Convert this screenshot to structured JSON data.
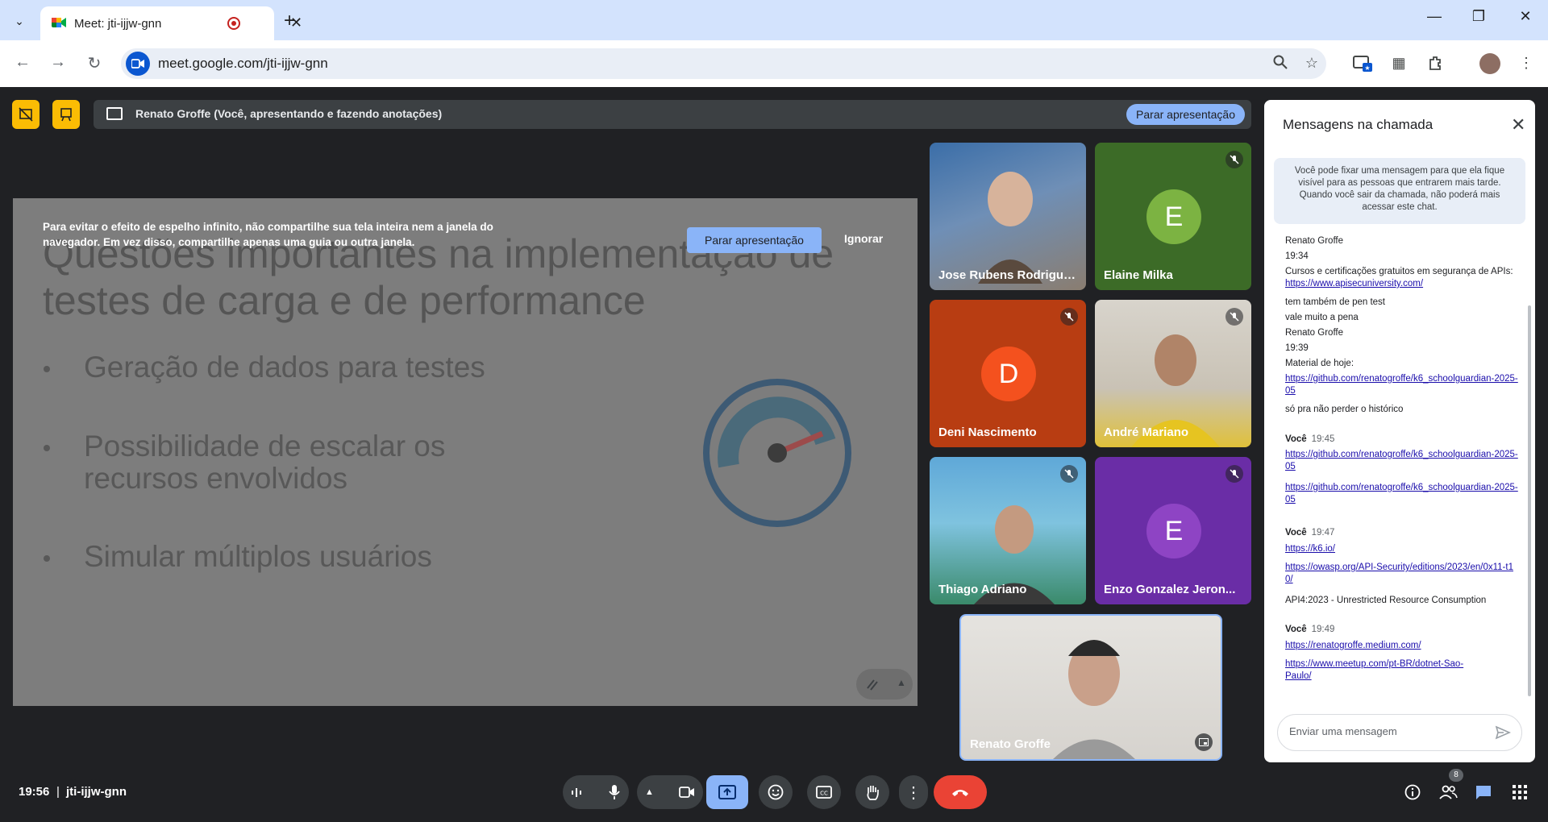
{
  "browser": {
    "tab_title": "Meet: jti-ijjw-gnn",
    "url": "meet.google.com/jti-ijjw-gnn"
  },
  "banner": {
    "text": "Renato Groffe (Você, apresentando e fazendo anotações)",
    "stop_label": "Parar apresentação"
  },
  "warning": {
    "text": "Para evitar o efeito de espelho infinito, não compartilhe sua tela inteira nem a janela do navegador. Em vez disso, compartilhe apenas uma guia ou outra janela.",
    "stop_label": "Parar apresentação",
    "ignore_label": "Ignorar"
  },
  "slide": {
    "title": "Questões importantes na implementação de testes de carga e de performance",
    "bullets": [
      "Geração de dados para testes",
      "Possibilidade de escalar os recursos envolvidos",
      "Simular múltiplos usuários"
    ]
  },
  "participants": [
    {
      "name": "Jose Rubens Rodrigues...",
      "muted": false,
      "type": "video"
    },
    {
      "name": "Elaine Milka",
      "muted": true,
      "type": "avatar",
      "initial": "E",
      "bg": "#3c6b27",
      "avatar_color": "#7cb342"
    },
    {
      "name": "Deni Nascimento",
      "muted": true,
      "type": "avatar",
      "initial": "D",
      "bg": "#b83d12",
      "avatar_color": "#f4511e"
    },
    {
      "name": "André Mariano",
      "muted": true,
      "type": "video"
    },
    {
      "name": "Thiago Adriano",
      "muted": true,
      "type": "video"
    },
    {
      "name": "Enzo Gonzalez Jeron...",
      "muted": true,
      "type": "avatar",
      "initial": "E",
      "bg": "#6a2da6",
      "avatar_color": "#8e44c4"
    },
    {
      "name": "Renato Groffe",
      "muted": false,
      "type": "self"
    }
  ],
  "chat": {
    "title": "Mensagens na chamada",
    "info": "Você pode fixar uma mensagem para que ela fique visível para as pessoas que entrarem mais tarde. Quando você sair da chamada, não poderá mais acessar este chat.",
    "input_placeholder": "Enviar uma mensagem",
    "messages": [
      {
        "line1": "Renato Groffe"
      },
      {
        "line1": "19:34"
      },
      {
        "text": "Cursos e certificações gratuitos em segurança de APIs: ",
        "link": "https://www.apisecuniversity.com/"
      },
      {
        "line1": "tem também de pen test"
      },
      {
        "line1": "vale muito a pena"
      },
      {
        "line1": "Renato Groffe"
      },
      {
        "line1": "19:39"
      },
      {
        "line1": "Material de hoje:"
      },
      {
        "link": "https://github.com/renatogroffe/k6_schoolguardian-2025-05"
      },
      {
        "line1": "só pra não perder o histórico"
      },
      {
        "sender": "Você",
        "time": "19:45"
      },
      {
        "link": "https://github.com/renatogroffe/k6_schoolguardian-2025-05"
      },
      {
        "link": "https://github.com/renatogroffe/k6_schoolguardian-2025-05"
      },
      {
        "sender": "Você",
        "time": "19:47"
      },
      {
        "link": "https://k6.io/"
      },
      {
        "link": "https://owasp.org/API-Security/editions/2023/en/0x11-t10/"
      },
      {
        "line1": "API4:2023 - Unrestricted Resource Consumption"
      },
      {
        "sender": "Você",
        "time": "19:49"
      },
      {
        "link": "https://renatogroffe.medium.com/"
      },
      {
        "link": "https://www.meetup.com/pt-BR/dotnet-Sao-Paulo/"
      }
    ]
  },
  "bottom": {
    "clock": "19:56",
    "separator": "|",
    "meeting_code": "jti-ijjw-gnn",
    "people_count": "8"
  },
  "colors": {
    "meet_bg": "#202124",
    "accent": "#8ab4f8",
    "end_call": "#ea4335",
    "highlight": "#fbbc04"
  }
}
